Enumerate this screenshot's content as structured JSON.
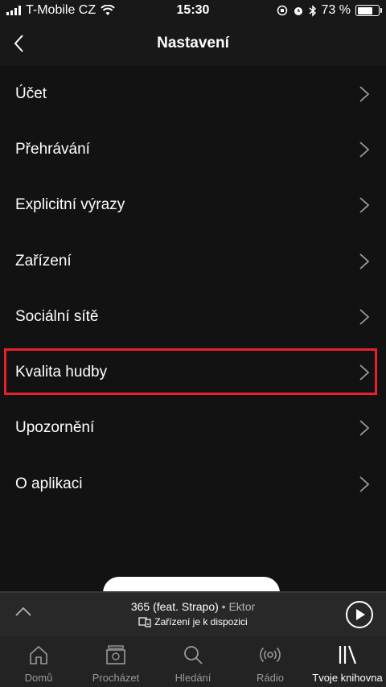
{
  "status_bar": {
    "carrier": "T-Mobile CZ",
    "time": "15:30",
    "battery": "73 %"
  },
  "header": {
    "title": "Nastavení"
  },
  "settings": {
    "items": [
      {
        "label": "Účet"
      },
      {
        "label": "Přehrávání"
      },
      {
        "label": "Explicitní výrazy"
      },
      {
        "label": "Zařízení"
      },
      {
        "label": "Sociální sítě"
      },
      {
        "label": "Kvalita hudby"
      },
      {
        "label": "Upozornění"
      },
      {
        "label": "O aplikaci"
      }
    ]
  },
  "now_playing": {
    "title": "365 (feat. Strapo)",
    "separator": "•",
    "artist": "Ektor",
    "device_text": "Zařízení je k dispozici"
  },
  "tabs": [
    {
      "label": "Domů",
      "icon": "home-icon"
    },
    {
      "label": "Procházet",
      "icon": "browse-icon"
    },
    {
      "label": "Hledání",
      "icon": "search-icon"
    },
    {
      "label": "Rádio",
      "icon": "radio-icon"
    },
    {
      "label": "Tvoje knihovna",
      "icon": "library-icon"
    }
  ],
  "colors": {
    "background": "#121212",
    "highlight": "#e8202a"
  }
}
